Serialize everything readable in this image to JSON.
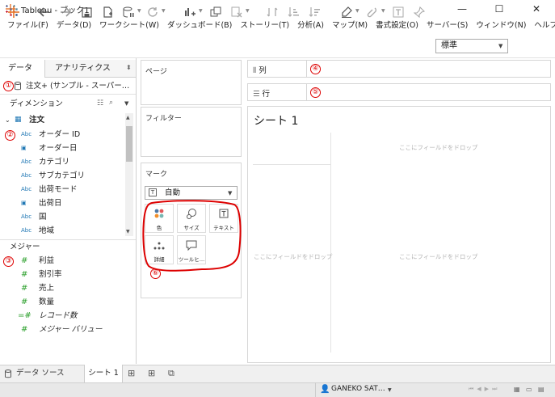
{
  "window": {
    "title": "Tableau - ブック1",
    "controls": [
      "—",
      "☐",
      "✕"
    ]
  },
  "menu": [
    "ファイル(F)",
    "データ(D)",
    "ワークシート(W)",
    "ダッシュボード(B)",
    "ストーリー(T)",
    "分析(A)",
    "マップ(M)",
    "書式設定(O)",
    "サーバー(S)",
    "ウィンドウ(N)",
    "ヘルプ(H)"
  ],
  "toolbar": {
    "fit_value": "標準",
    "icons": [
      "tableau-logo-icon",
      "undo-icon",
      "redo-icon",
      "save-icon",
      "new-datasource-icon",
      "pause-icon",
      "refresh-icon",
      "new-sheet-icon",
      "duplicate-sheet-icon",
      "clear-sheet-icon",
      "swap-icon",
      "sort-asc-icon",
      "sort-desc-icon",
      "highlight-icon",
      "group-icon",
      "label-icon",
      "pin-icon"
    ]
  },
  "left_pane": {
    "tab_data": "データ",
    "tab_analytics": "アナリティクス",
    "datasource": "注文+ (サンプル - スーパー…",
    "dimensions_header": "ディメンション",
    "table_name": "注文",
    "dimensions": [
      {
        "type": "Abc",
        "name": "オーダー ID"
      },
      {
        "type": "date",
        "name": "オーダー日"
      },
      {
        "type": "Abc",
        "name": "カテゴリ"
      },
      {
        "type": "Abc",
        "name": "サブカテゴリ"
      },
      {
        "type": "Abc",
        "name": "出荷モード"
      },
      {
        "type": "date",
        "name": "出荷日"
      },
      {
        "type": "Abc",
        "name": "国"
      },
      {
        "type": "Abc",
        "name": "地域"
      }
    ],
    "measures_header": "メジャー",
    "measures": [
      {
        "type": "#",
        "name": "利益"
      },
      {
        "type": "#",
        "name": "割引率"
      },
      {
        "type": "#",
        "name": "売上"
      },
      {
        "type": "#",
        "name": "数量"
      },
      {
        "type": "=#",
        "name": "レコード数"
      },
      {
        "type": "#",
        "name": "メジャー バリュー"
      }
    ]
  },
  "cards": {
    "pages": "ページ",
    "filters": "フィルター",
    "marks": "マーク",
    "mark_type": "自動",
    "mark_buttons": [
      {
        "name": "color",
        "label": "色"
      },
      {
        "name": "size",
        "label": "サイズ"
      },
      {
        "name": "text",
        "label": "テキスト"
      },
      {
        "name": "detail",
        "label": "詳細"
      },
      {
        "name": "tooltip",
        "label": "ツールヒ…"
      }
    ]
  },
  "shelves": {
    "columns": "列",
    "rows": "行"
  },
  "sheet": {
    "title": "シート 1",
    "drop_hint": "ここにフィールドをドロップ"
  },
  "annotations": [
    "①",
    "②",
    "③",
    "④",
    "⑤",
    "⑥"
  ],
  "bottom": {
    "datasource_tab": "データ ソース",
    "sheet_tab": "シート 1",
    "user": "GANEKO SAT…"
  },
  "colors": {
    "annotation": "#dd0000",
    "dimension_icon": "#1f77b4",
    "measure_icon": "#2ca02c"
  }
}
